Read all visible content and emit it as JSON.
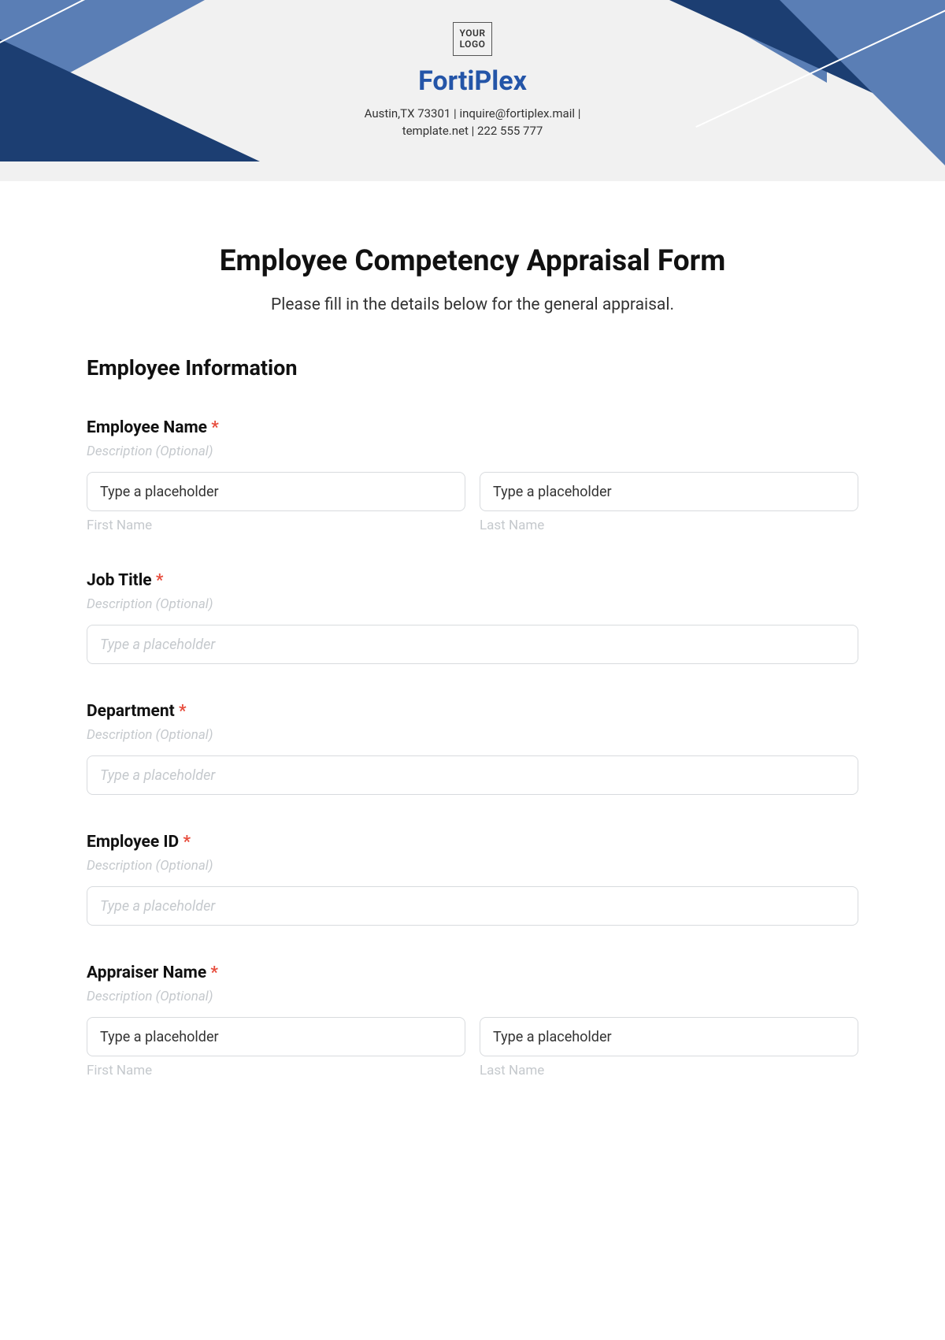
{
  "header": {
    "logo_line1": "YOUR",
    "logo_line2": "LOGO",
    "company": "FortiPlex",
    "contact_line1": "Austin,TX 73301 | inquire@fortiplex.mail |",
    "contact_line2": "template.net | 222 555 777"
  },
  "form": {
    "title": "Employee Competency Appraisal Form",
    "subtitle": "Please fill in the details below for the general appraisal.",
    "section1": "Employee Information",
    "required_mark": "*",
    "desc_text": "Description (Optional)",
    "sublabel_first": "First Name",
    "sublabel_last": "Last Name",
    "ph_dark": "Type a placeholder",
    "ph_light": "Type a placeholder",
    "fields": {
      "employee_name": "Employee Name",
      "job_title": "Job Title",
      "department": "Department",
      "employee_id": "Employee ID",
      "appraiser_name": "Appraiser Name"
    }
  }
}
